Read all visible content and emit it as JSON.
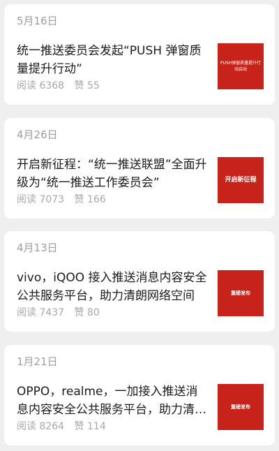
{
  "articles": [
    {
      "date": "5月16日",
      "title": "统一推送委员会发起“PUSH 弹窗质量提升行动”",
      "read_label": "阅读",
      "read_count": "6368",
      "like_label": "赞",
      "like_count": "55",
      "thumb_text": "PUSH弹窗质量提升行动启动",
      "thumb_color": "#c8231a"
    },
    {
      "date": "4月26日",
      "title": "开启新征程：“统一推送联盟”全面升级为“统一推送工作委员会”",
      "read_label": "阅读",
      "read_count": "7073",
      "like_label": "赞",
      "like_count": "166",
      "thumb_text": "开启新征程",
      "thumb_color": "#c8231a"
    },
    {
      "date": "4月13日",
      "title": "vivo，iQOO 接入推送消息内容安全公共服务平台，助力清朗网络空间",
      "read_label": "阅读",
      "read_count": "7437",
      "like_label": "赞",
      "like_count": "80",
      "thumb_text": "重磅发布",
      "thumb_color": "#c8231a"
    },
    {
      "date": "1月21日",
      "title": "OPPO，realme，一加接入推送消息内容安全公共服务平台，助力清朗网络空间",
      "read_label": "阅读",
      "read_count": "8264",
      "like_label": "赞",
      "like_count": "114",
      "thumb_text": "重磅发布",
      "thumb_color": "#c8231a"
    }
  ]
}
